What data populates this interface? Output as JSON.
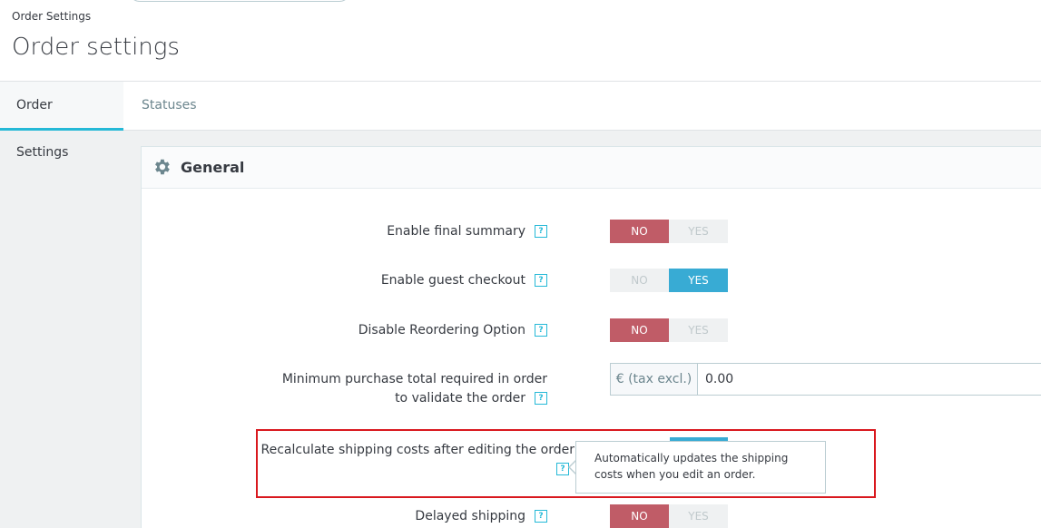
{
  "header": {
    "breadcrumb": "Order Settings",
    "title": "Order settings"
  },
  "tabs": [
    {
      "label": "Order Settings",
      "active": true
    },
    {
      "label": "Statuses",
      "active": false
    }
  ],
  "panel": {
    "icon": "gear-icon",
    "title": "General"
  },
  "fields": {
    "final_summary": {
      "label": "Enable final summary",
      "value": "NO"
    },
    "guest_checkout": {
      "label": "Enable guest checkout",
      "value": "YES"
    },
    "disable_reordering": {
      "label": "Disable Reordering Option",
      "value": "NO"
    },
    "min_purchase": {
      "label": "Minimum purchase total required in order to validate the order",
      "addon": "€ (tax excl.)",
      "value": "0.00"
    },
    "recalculate_shipping": {
      "label": "Recalculate shipping costs after editing the order",
      "value": "YES"
    },
    "delayed_shipping": {
      "label": "Delayed shipping",
      "value": "NO"
    }
  },
  "switch_labels": {
    "no": "NO",
    "yes": "YES"
  },
  "help_glyph": "?",
  "tooltip": {
    "text": "Automatically updates the shipping costs when you edit an order."
  },
  "colors": {
    "accent": "#25b9d7",
    "no_active": "#c05c67",
    "yes_active": "#38abd4",
    "highlight": "#d9181e"
  }
}
